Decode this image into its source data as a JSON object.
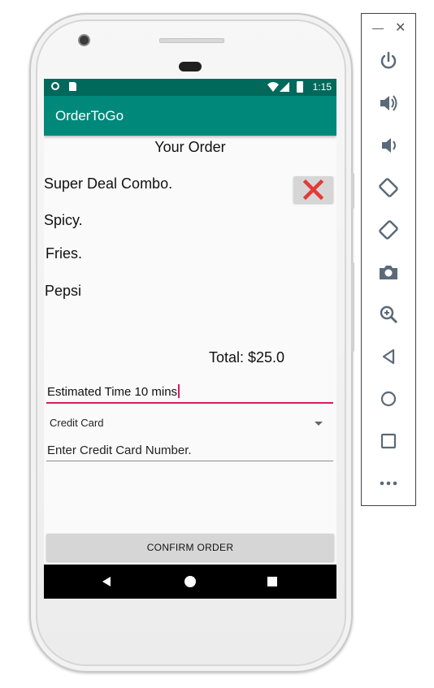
{
  "status_bar": {
    "time": "1:15"
  },
  "app_bar": {
    "title": "OrderToGo"
  },
  "order": {
    "heading": "Your Order",
    "items": [
      "Super Deal Combo.",
      "Spicy.",
      "Fries.",
      "Pepsi"
    ],
    "total": "Total: $25.0"
  },
  "form": {
    "estimated_time_value": "Estimated Time 10 mins",
    "payment_method": "Credit Card",
    "card_number_placeholder": "Enter Credit Card Number.",
    "confirm_label": "CONFIRM ORDER"
  },
  "colors": {
    "status_bar": "#00695c",
    "app_bar": "#00897b",
    "accent": "#d81b60",
    "remove_icon": "#e53935"
  },
  "icons": {
    "remove_button": "close-icon",
    "toolbar": [
      "power-icon",
      "volume-up-icon",
      "volume-down-icon",
      "rotate-left-icon",
      "rotate-right-icon",
      "camera-icon",
      "zoom-icon",
      "back-icon",
      "home-icon",
      "overview-icon",
      "more-icon"
    ]
  }
}
